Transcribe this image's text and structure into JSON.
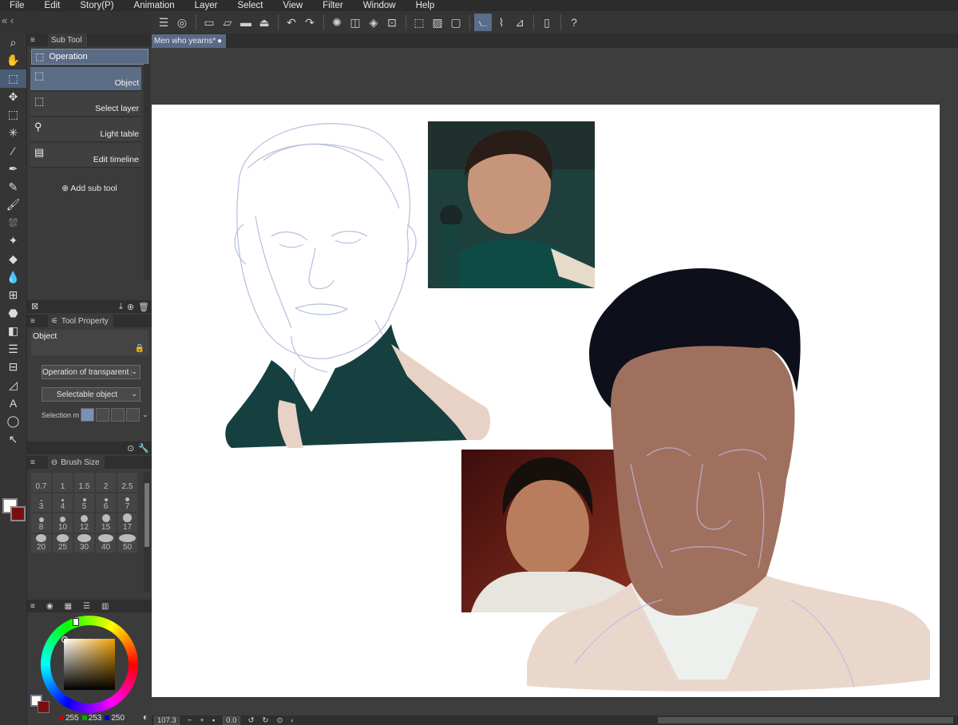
{
  "menu": [
    "File",
    "Edit",
    "Story(P)",
    "Animation",
    "Layer",
    "Select",
    "View",
    "Filter",
    "Window",
    "Help"
  ],
  "subtool": {
    "tab_label": "Sub Tool",
    "group_label": "Operation",
    "items": [
      {
        "label": "Object",
        "icon": "object-cursor-icon",
        "active": true
      },
      {
        "label": "Select layer",
        "icon": "select-layer-icon",
        "active": false
      },
      {
        "label": "Light table",
        "icon": "light-table-icon",
        "active": false
      },
      {
        "label": "Edit timeline",
        "icon": "edit-timeline-icon",
        "active": false
      }
    ],
    "add_label": "Add sub tool"
  },
  "toolprop": {
    "tab_label": "Tool Property",
    "title": "Object",
    "dropdown1": "Operation of transparent part",
    "dropdown2": "Selectable object",
    "selection_label": "Selection m"
  },
  "brush": {
    "tab_label": "Brush Size",
    "sizes": [
      "0.7",
      "1",
      "1.5",
      "2",
      "2.5",
      "3",
      "4",
      "5",
      "6",
      "7",
      "8",
      "10",
      "12",
      "15",
      "17",
      "20",
      "25",
      "30",
      "40",
      "50"
    ]
  },
  "color": {
    "r": "255",
    "g": "253",
    "b": "250",
    "main_color": "#fffdfa",
    "sub_color": "#7a0e0e"
  },
  "document": {
    "tab_label": "Men who yearns*"
  },
  "status": {
    "zoom": "107.3",
    "angle": "0.0"
  }
}
